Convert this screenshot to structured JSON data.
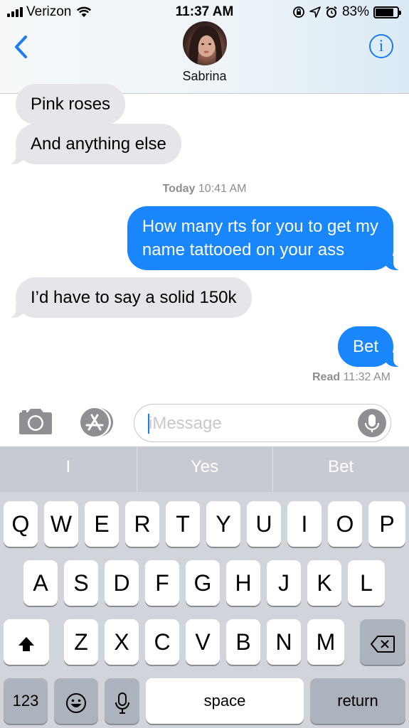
{
  "status_bar": {
    "carrier": "Verizon",
    "time": "11:37 AM",
    "battery": "83%",
    "battery_level": 0.83
  },
  "header": {
    "contact_name": "Sabrina"
  },
  "messages": [
    {
      "side": "in",
      "text": "Pink roses"
    },
    {
      "side": "in",
      "text": "And anything else"
    },
    {
      "side": "out",
      "text": "How many rts for you to get my\nname tattooed on your ass"
    },
    {
      "side": "in",
      "text": "I’d have to say a solid 150k"
    },
    {
      "side": "out",
      "text": "Bet"
    }
  ],
  "timestamp": {
    "day": "Today",
    "time": "10:41 AM"
  },
  "read_receipt": {
    "label": "Read",
    "time": "11:32 AM"
  },
  "composer": {
    "placeholder": "iMessage",
    "value": ""
  },
  "predictions": [
    "I",
    "Yes",
    "Bet"
  ],
  "keyboard": {
    "row1": [
      "Q",
      "W",
      "E",
      "R",
      "T",
      "Y",
      "U",
      "I",
      "O",
      "P"
    ],
    "row2": [
      "A",
      "S",
      "D",
      "F",
      "G",
      "H",
      "J",
      "K",
      "L"
    ],
    "row3": [
      "Z",
      "X",
      "C",
      "V",
      "B",
      "N",
      "M"
    ],
    "numbers_label": "123",
    "space_label": "space",
    "return_label": "return"
  },
  "colors": {
    "outgoing_bubble": "#1a86fb",
    "incoming_bubble": "#e5e5ea",
    "accent": "#1a7cf0"
  }
}
